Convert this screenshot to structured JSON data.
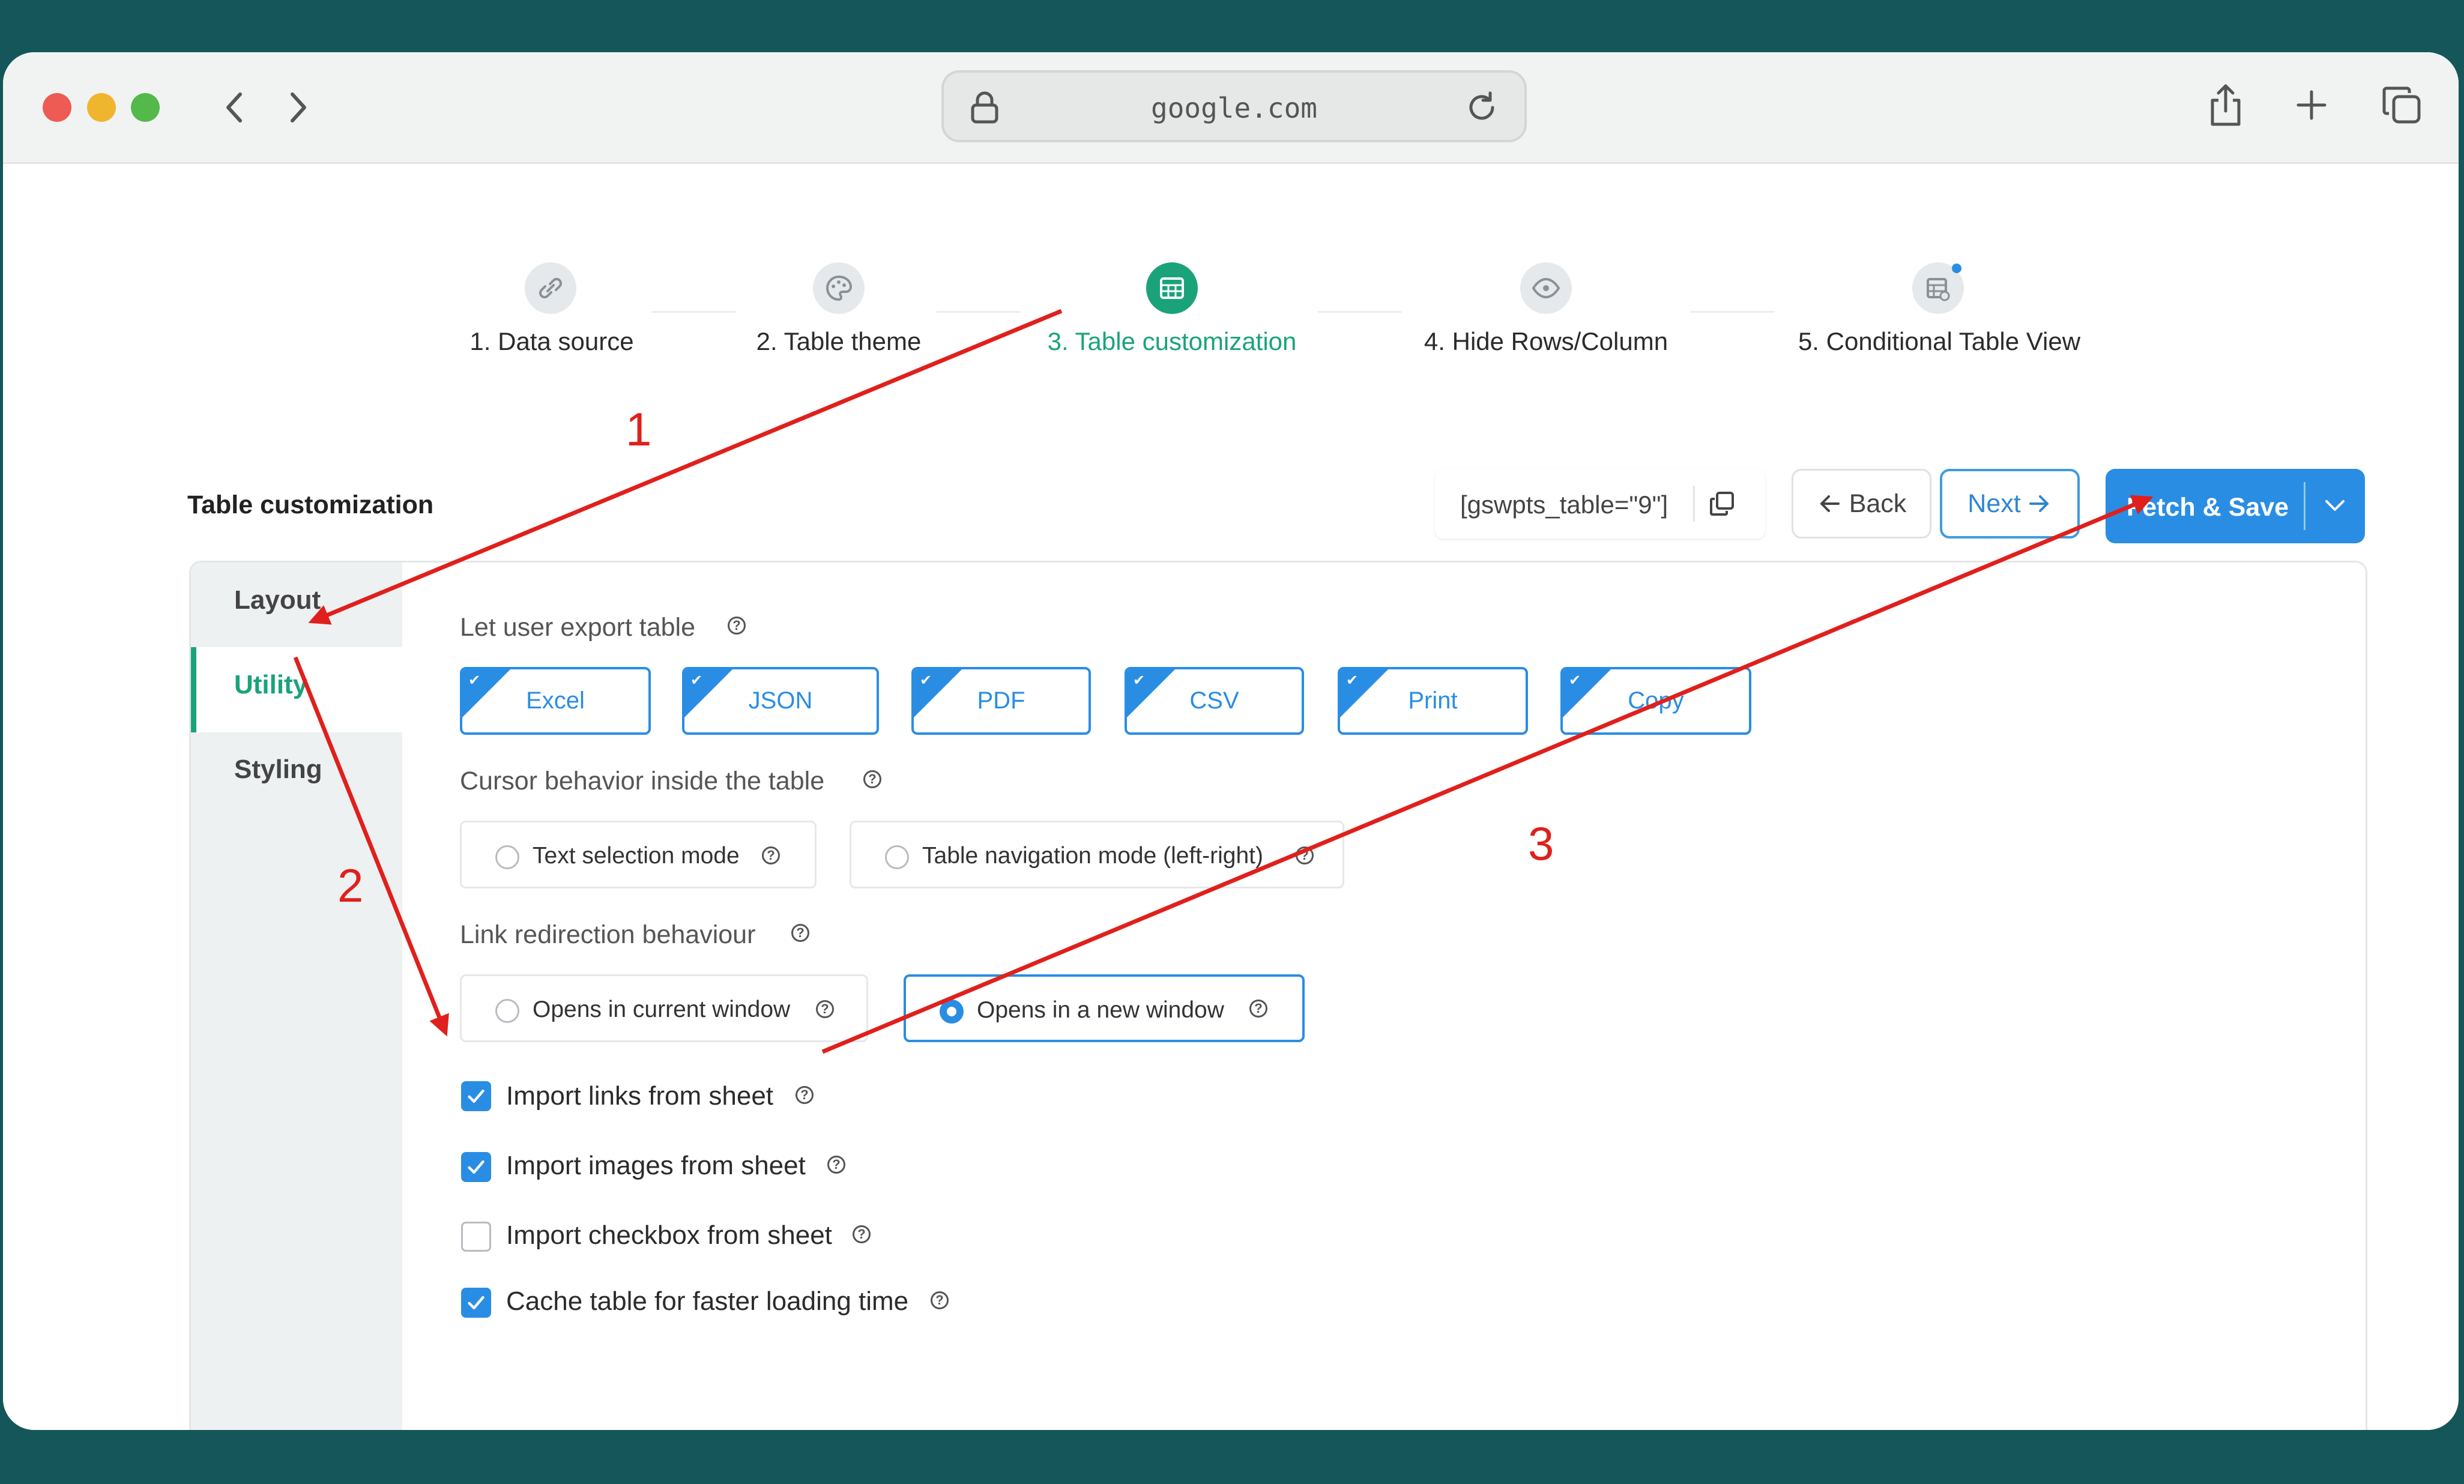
{
  "browser": {
    "url": "google.com"
  },
  "steps": [
    {
      "label": "1. Data source",
      "icon": "link-icon"
    },
    {
      "label": "2. Table theme",
      "icon": "palette-icon"
    },
    {
      "label": "3. Table customization",
      "icon": "table-icon",
      "active": true
    },
    {
      "label": "4. Hide Rows/Column",
      "icon": "eye-icon"
    },
    {
      "label": "5. Conditional Table View",
      "icon": "conditional-table-icon"
    }
  ],
  "header": {
    "title": "Table customization",
    "shortcode": "[gswpts_table=\"9\"]",
    "back_label": "Back",
    "next_label": "Next",
    "fetch_label": "Fetch & Save"
  },
  "sidebar": {
    "items": [
      {
        "label": "Layout"
      },
      {
        "label": "Utility",
        "active": true
      },
      {
        "label": "Styling"
      }
    ]
  },
  "utility": {
    "export_title": "Let user export table",
    "export_options": [
      {
        "label": "Excel",
        "checked": true
      },
      {
        "label": "JSON",
        "checked": true
      },
      {
        "label": "PDF",
        "checked": true
      },
      {
        "label": "CSV",
        "checked": true
      },
      {
        "label": "Print",
        "checked": true
      },
      {
        "label": "Copy",
        "checked": true
      }
    ],
    "cursor_title": "Cursor behavior inside the table",
    "cursor_options": [
      {
        "label": "Text selection mode",
        "selected": false
      },
      {
        "label": "Table navigation mode (left-right)",
        "selected": false
      }
    ],
    "link_title": "Link redirection behaviour",
    "link_options": [
      {
        "label": "Opens in current window",
        "selected": false
      },
      {
        "label": "Opens in a new window",
        "selected": true
      }
    ],
    "checkboxes": [
      {
        "label": "Import links from sheet",
        "checked": true
      },
      {
        "label": "Import images from sheet",
        "checked": true
      },
      {
        "label": "Import checkbox from sheet",
        "checked": false
      },
      {
        "label": "Cache table for faster loading time",
        "checked": true
      }
    ]
  },
  "annotations": {
    "one": "1",
    "two": "2",
    "three": "3"
  },
  "colors": {
    "accent": "#2a8de4",
    "active_step": "#1aa37a",
    "annotation": "#e0201c",
    "background": "#15565a"
  }
}
